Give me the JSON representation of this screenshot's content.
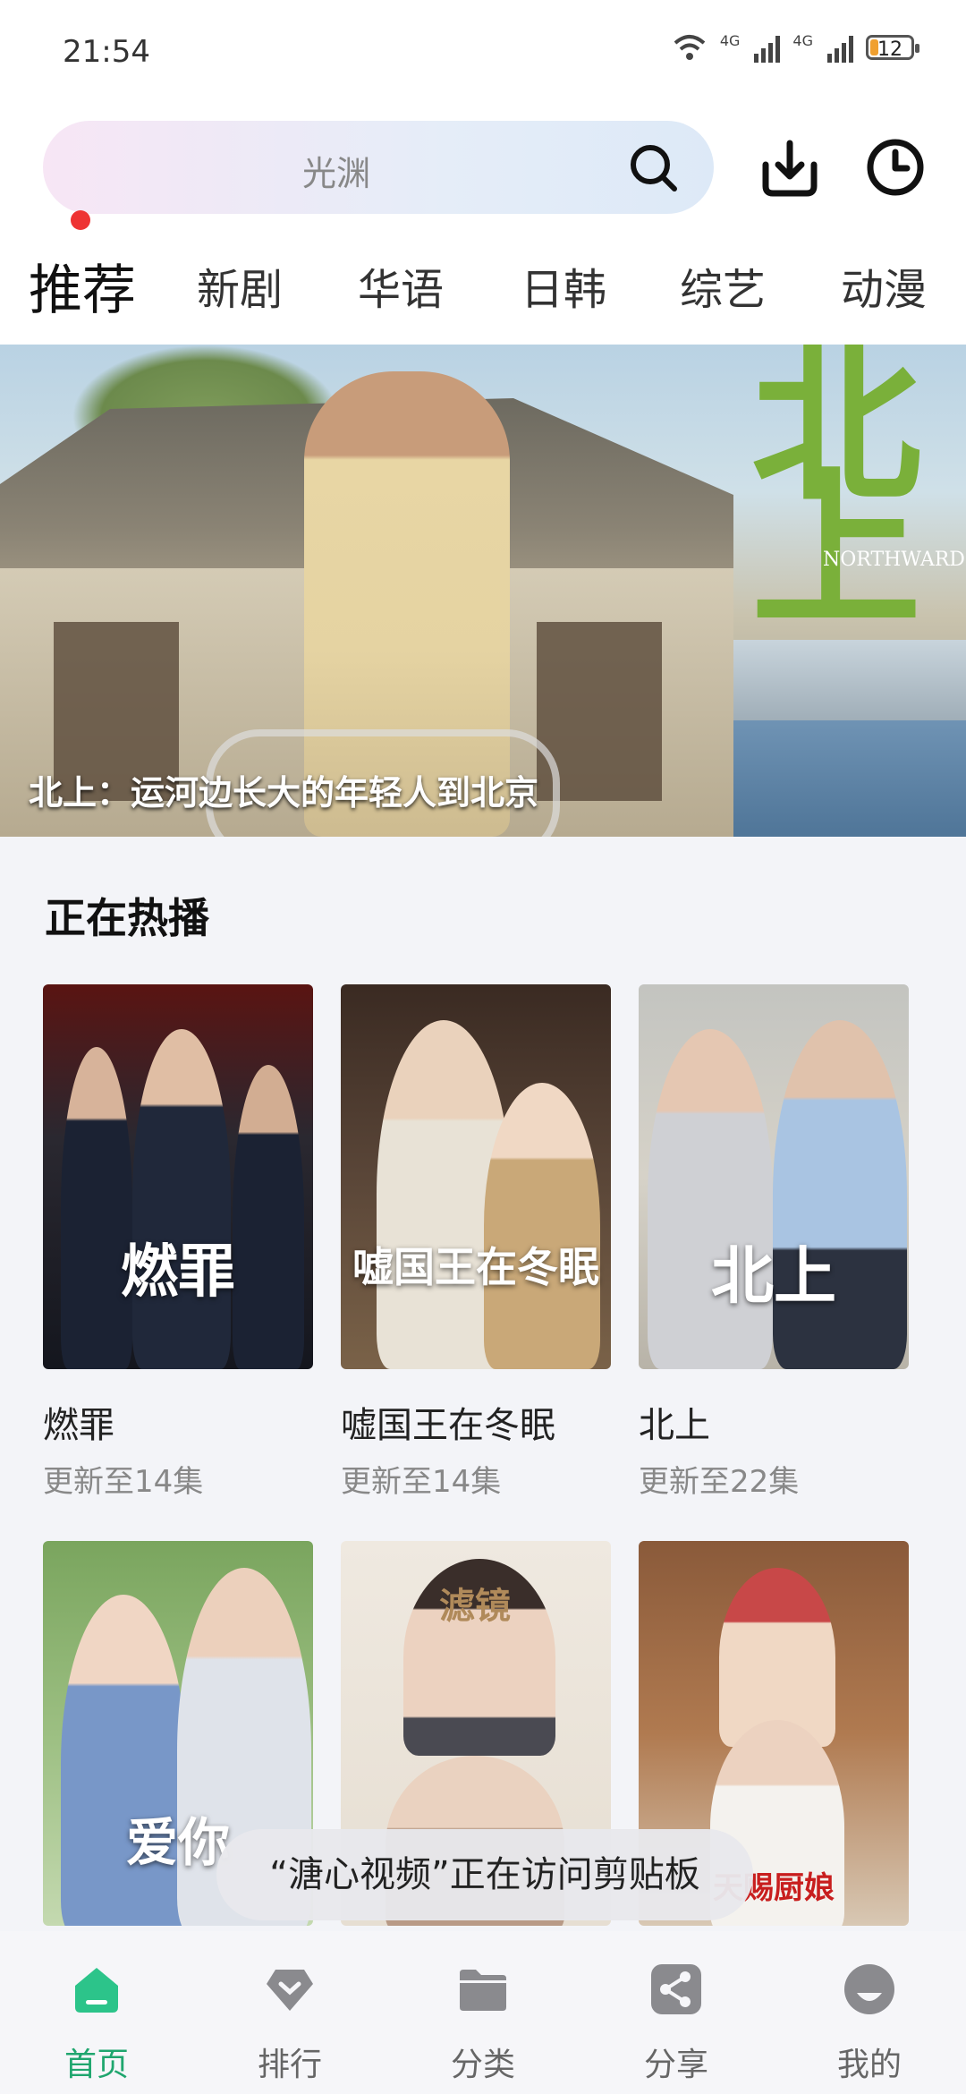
{
  "status_bar": {
    "time": "21:54",
    "network_1": "4G",
    "network_2": "4G",
    "battery": "12"
  },
  "header": {
    "search_placeholder": "光渊",
    "icons": [
      "search-icon",
      "download-icon",
      "history-icon"
    ]
  },
  "tabs": [
    {
      "label": "推荐",
      "active": true
    },
    {
      "label": "新剧"
    },
    {
      "label": "华语"
    },
    {
      "label": "日韩"
    },
    {
      "label": "综艺"
    },
    {
      "label": "动漫"
    }
  ],
  "banner": {
    "caption": "北上：运河边长大的年轻人到北京",
    "poster_title": "北上",
    "poster_subtitle": "NORTHWARD"
  },
  "hot_section": {
    "title": "正在热播",
    "items": [
      {
        "name": "燃罪",
        "update": "更新至14集",
        "poster_text": "燃罪"
      },
      {
        "name": "嘘国王在冬眠",
        "update": "更新至14集",
        "poster_text": "嘘国王在冬眠"
      },
      {
        "name": "北上",
        "update": "更新至22集",
        "poster_text": "北上"
      },
      {
        "name": "",
        "update": "",
        "poster_text": "爱你"
      },
      {
        "name": "",
        "update": "",
        "poster_text": "滤镜"
      },
      {
        "name": "",
        "update": "",
        "poster_text": "天赐厨娘"
      }
    ]
  },
  "toast": "“溏心视频”正在访问剪贴板",
  "bottom_nav": [
    {
      "label": "首页",
      "icon": "home-icon",
      "active": true
    },
    {
      "label": "排行",
      "icon": "ranking-icon"
    },
    {
      "label": "分类",
      "icon": "folder-icon"
    },
    {
      "label": "分享",
      "icon": "share-icon"
    },
    {
      "label": "我的",
      "icon": "profile-icon"
    }
  ],
  "colors": {
    "accent": "#1fa66e",
    "tab_dot": "#ee3333",
    "banner_title": "#7ab03a"
  }
}
